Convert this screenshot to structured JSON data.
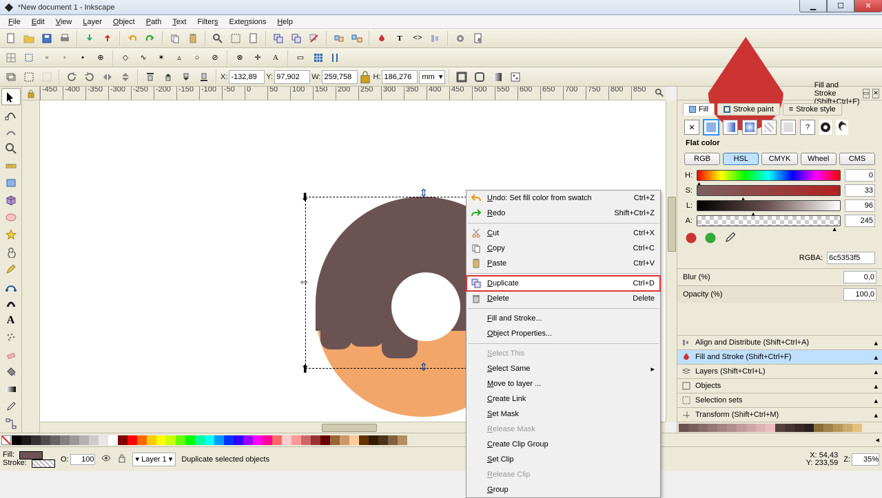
{
  "window": {
    "title": "*New document 1 - Inkscape"
  },
  "menubar": [
    "File",
    "Edit",
    "View",
    "Layer",
    "Object",
    "Path",
    "Text",
    "Filters",
    "Extensions",
    "Help"
  ],
  "tool_options": {
    "x_label": "X:",
    "x": "-132,89",
    "y_label": "Y:",
    "y": "97,902",
    "w_label": "W:",
    "w": "259,758",
    "h_label": "H:",
    "h": "186,276",
    "unit": "mm"
  },
  "ruler_h": [
    "-450",
    "-400",
    "-350",
    "-300",
    "-250",
    "-200",
    "-150",
    "-100",
    "-50",
    "0",
    "50",
    "100",
    "150",
    "200",
    "250",
    "300",
    "350",
    "400",
    "450",
    "500",
    "550",
    "600",
    "650",
    "700",
    "750",
    "800",
    "850"
  ],
  "docker": {
    "title": "Fill and Stroke (Shift+Ctrl+F)",
    "tabs": [
      "Fill",
      "Stroke paint",
      "Stroke style"
    ],
    "flat_color_label": "Flat color",
    "modes": [
      "RGB",
      "HSL",
      "CMYK",
      "Wheel",
      "CMS"
    ],
    "sliders": {
      "H": {
        "label": "H:",
        "value": "0"
      },
      "S": {
        "label": "S:",
        "value": "33"
      },
      "L": {
        "label": "L:",
        "value": "96"
      },
      "A": {
        "label": "A:",
        "value": "245"
      }
    },
    "rgba_label": "RGBA:",
    "rgba_value": "6c5353f5",
    "blur_label": "Blur (%)",
    "blur_value": "0,0",
    "opacity_label": "Opacity (%)",
    "opacity_value": "100,0",
    "panels": [
      "Align and Distribute (Shift+Ctrl+A)",
      "Fill and Stroke (Shift+Ctrl+F)",
      "Layers (Shift+Ctrl+L)",
      "Objects",
      "Selection sets",
      "Transform (Shift+Ctrl+M)"
    ]
  },
  "context_menu": [
    {
      "icon": "undo",
      "label": "Undo: Set fill color from swatch",
      "shortcut": "Ctrl+Z"
    },
    {
      "icon": "redo",
      "label": "Redo",
      "shortcut": "Shift+Ctrl+Z"
    },
    {
      "sep": true
    },
    {
      "icon": "cut",
      "label": "Cut",
      "shortcut": "Ctrl+X"
    },
    {
      "icon": "copy",
      "label": "Copy",
      "shortcut": "Ctrl+C"
    },
    {
      "icon": "paste",
      "label": "Paste",
      "shortcut": "Ctrl+V"
    },
    {
      "sep": true
    },
    {
      "icon": "dup",
      "label": "Duplicate",
      "shortcut": "Ctrl+D",
      "hl": true
    },
    {
      "icon": "del",
      "label": "Delete",
      "shortcut": "Delete"
    },
    {
      "sep": true
    },
    {
      "label": "Fill and Stroke..."
    },
    {
      "label": "Object Properties..."
    },
    {
      "sep": true
    },
    {
      "label": "Select This",
      "disabled": true
    },
    {
      "label": "Select Same",
      "submenu": true
    },
    {
      "label": "Move to layer ..."
    },
    {
      "label": "Create Link"
    },
    {
      "label": "Set Mask"
    },
    {
      "label": "Release Mask",
      "disabled": true
    },
    {
      "label": "Create Clip Group"
    },
    {
      "label": "Set Clip"
    },
    {
      "label": "Release Clip",
      "disabled": true
    },
    {
      "label": "Group"
    }
  ],
  "status": {
    "fill_label": "Fill:",
    "stroke_label": "Stroke:",
    "opacity_label": "O:",
    "opacity": "100",
    "layer": "Layer 1",
    "message": "Duplicate selected objects",
    "x_label": "X:",
    "x": "54,43",
    "y_label": "Y:",
    "y": "233,59",
    "z_label": "Z:",
    "z": "35%"
  },
  "palette_colors": [
    "#000000",
    "#1a1a1a",
    "#333333",
    "#4d4d4d",
    "#666666",
    "#808080",
    "#999999",
    "#b3b3b3",
    "#cccccc",
    "#e6e6e6",
    "#ffffff",
    "#800000",
    "#ff0000",
    "#ff6600",
    "#ffcc00",
    "#ffff00",
    "#ccff00",
    "#66ff00",
    "#00ff00",
    "#00ff99",
    "#00ffff",
    "#0099ff",
    "#0033ff",
    "#3300ff",
    "#9900ff",
    "#ff00ff",
    "#ff0099",
    "#ff6666",
    "#ffcccc",
    "#ff9999",
    "#cc6666",
    "#993333",
    "#660000",
    "#996633",
    "#cc9966",
    "#ffcc99",
    "#663300",
    "#331a00",
    "#4d3319",
    "#806040",
    "#b38f60"
  ],
  "docker_palette": [
    "#6c5353",
    "#7a5f5f",
    "#886b6b",
    "#967777",
    "#a48383",
    "#b28f8f",
    "#c09b9b",
    "#cea7a7",
    "#dcb3b3",
    "#eabfbf",
    "#553f3f",
    "#473434",
    "#392929",
    "#2b1f1f",
    "#8a6d3b",
    "#a0824b",
    "#b6975b",
    "#ccac6b",
    "#e2c17b"
  ]
}
